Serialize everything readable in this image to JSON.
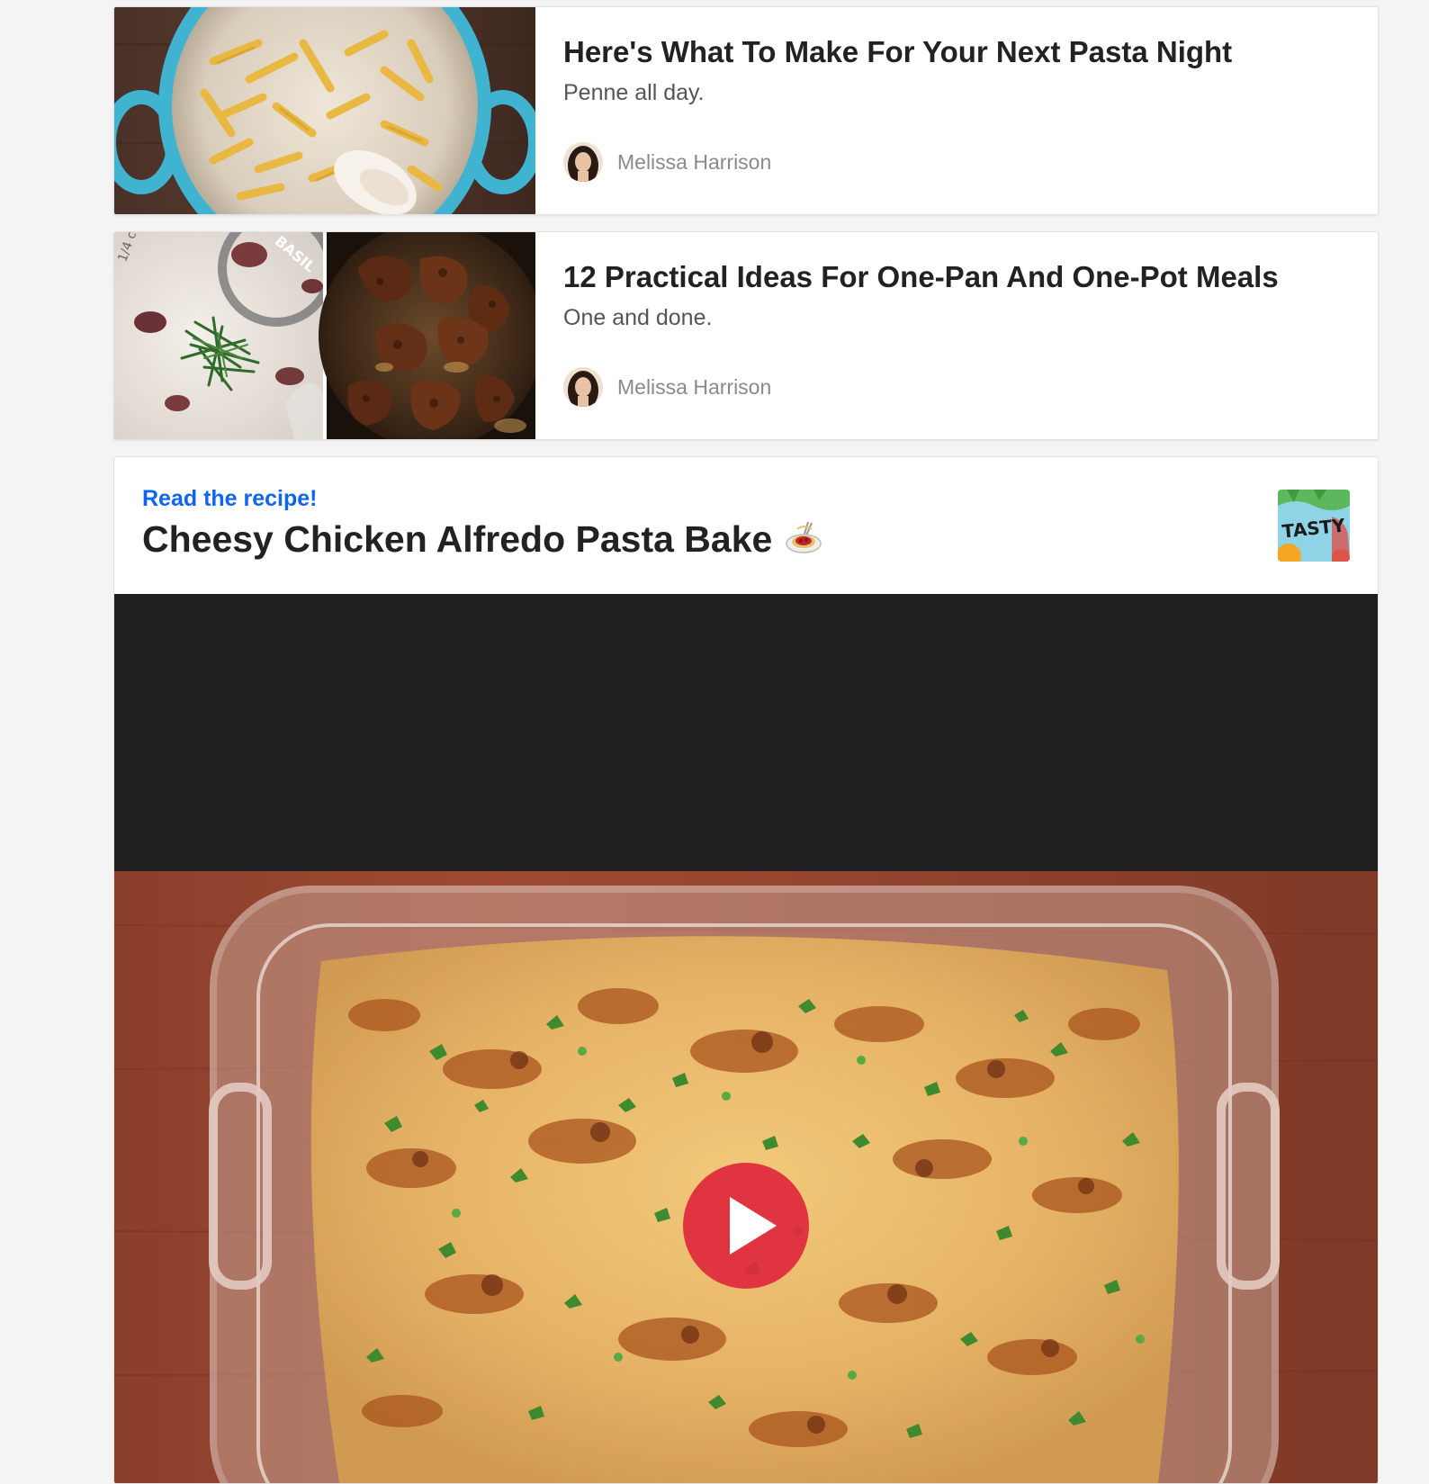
{
  "articles": [
    {
      "title": "Here's What To Make For Your Next Pasta Night",
      "description": "Penne all day.",
      "author": "Melissa Harrison",
      "thumbnail_icon": "penne-pot-image"
    },
    {
      "title": "12 Practical Ideas For One-Pan And One-Pot Meals",
      "description": "One and done.",
      "author": "Melissa Harrison",
      "thumbnail_icon": "creamy-chicken-skillet-image"
    }
  ],
  "video_recipe": {
    "link_label": "Read the recipe!",
    "title": "Cheesy Chicken Alfredo Pasta Bake",
    "title_emoji": "spaghetti-icon",
    "logo_text": "TASTY",
    "play_icon": "play-icon",
    "poster_icon": "pasta-bake-image"
  },
  "colors": {
    "link": "#0f65ef",
    "title": "#222222",
    "muted": "#8a8a8a",
    "play": "#de283c",
    "page_bg": "#f4f4f4"
  }
}
